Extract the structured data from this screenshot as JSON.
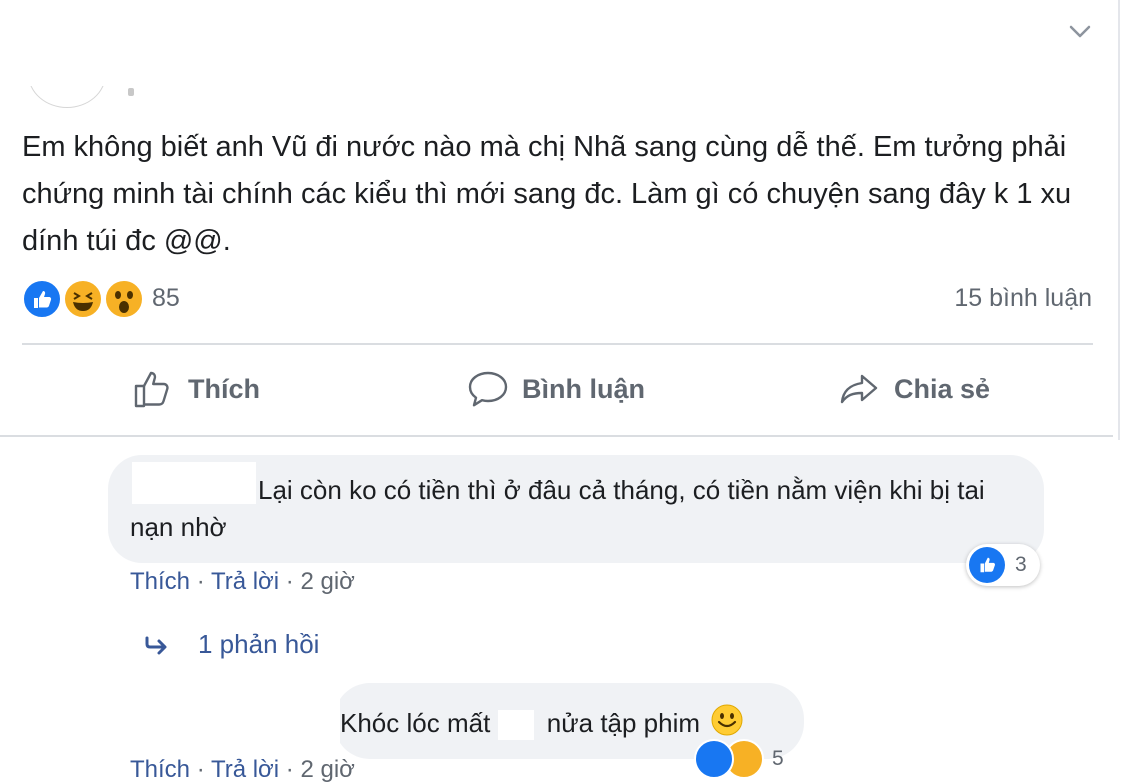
{
  "post": {
    "text": "Em không biết anh Vũ đi nước nào mà chị Nhã sang cùng dễ thế. Em tưởng phải chứng minh tài chính các kiểu thì mới sang đc. Làm gì có chuyện sang đây k 1 xu dính túi đc @@.",
    "reactions_count": "85",
    "comments_count": "15 bình luận"
  },
  "actions": {
    "like": "Thích",
    "comment": "Bình luận",
    "share": "Chia sẻ"
  },
  "comment1": {
    "text": "Lại còn ko có tiền thì ở đâu cả tháng, có tiền nằm viện khi bị tai nạn nhờ",
    "reaction_count": "3",
    "like": "Thích",
    "reply": "Trả lời",
    "time": "2 giờ",
    "sep": "·"
  },
  "replies": {
    "label": "1 phản hồi"
  },
  "reply1": {
    "text_a": "Khóc lóc mất",
    "text_b": "nửa tập phim",
    "reaction_count": "5",
    "like": "Thích",
    "reply": "Trả lời",
    "time": "2 giờ"
  },
  "colors": {
    "link": "#385898",
    "like_blue": "#1877f2",
    "emoji_yellow": "#f7b125",
    "bubble": "#f0f2f5",
    "muted": "#606770"
  }
}
